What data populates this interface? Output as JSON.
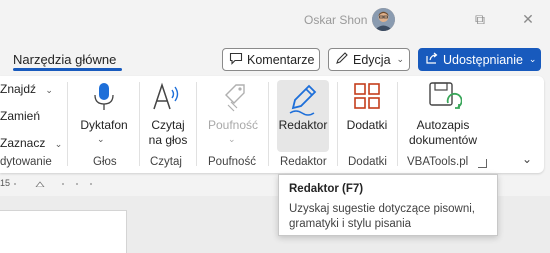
{
  "titlebar": {
    "user_name": "Oskar Shon",
    "restore_glyph": "⧉",
    "close_glyph": "✕"
  },
  "tabs": {
    "home_label": "Narzędzia główne"
  },
  "actions": {
    "comments_label": "Komentarze",
    "editing_label": "Edycja",
    "share_label": "Udostępnianie"
  },
  "ribbon": {
    "editing": {
      "find_label": "Znajdź",
      "replace_label": "Zamień",
      "select_label": "Zaznacz",
      "group_label": "dytowanie"
    },
    "voice": {
      "dictate_label": "Dyktafon",
      "group_label": "Głos"
    },
    "speech": {
      "read_aloud_line1": "Czytaj",
      "read_aloud_line2": "na głos",
      "group_label": "Czytaj"
    },
    "sensitivity": {
      "button_label": "Poufność",
      "group_label": "Poufność"
    },
    "editor": {
      "button_label": "Redaktor",
      "group_label": "Redaktor"
    },
    "addins": {
      "button_label": "Dodatki",
      "group_label": "Dodatki"
    },
    "vba": {
      "autosave_line1": "Autozapis",
      "autosave_line2": "dokumentów",
      "group_label": "VBATools.pl"
    },
    "collapse_glyph": "⌄"
  },
  "ruler": {
    "number": "15"
  },
  "tooltip": {
    "title": "Redaktor (F7)",
    "description": "Uzyskaj sugestie dotyczące pisowni, gramatyki i stylu pisania"
  },
  "colors": {
    "accent": "#185abd",
    "share_bg": "#185abd",
    "addins_icon": "#c43e1c",
    "autosave_icon": "#3aa65a"
  }
}
